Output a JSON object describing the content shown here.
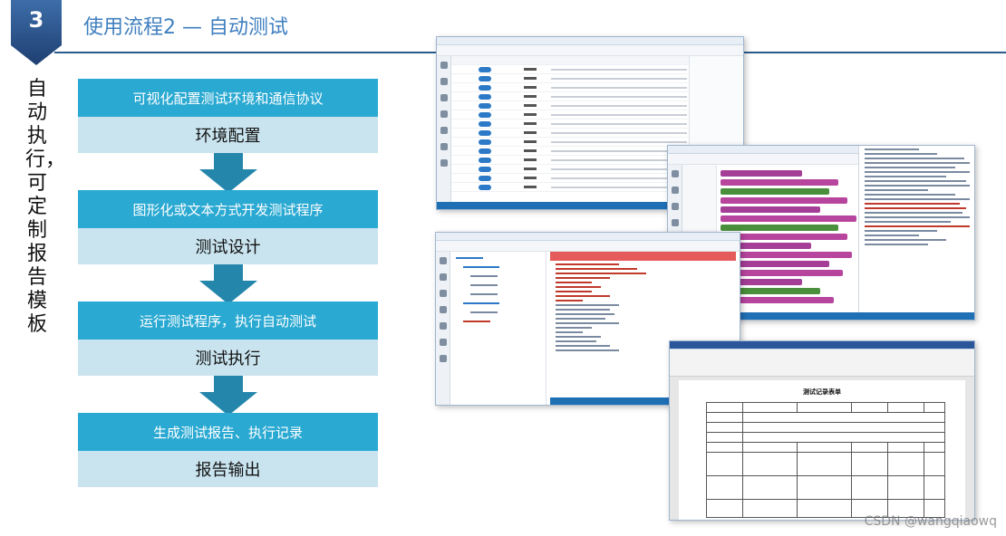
{
  "header": {
    "number": "3",
    "title": "使用流程2 — 自动测试"
  },
  "side_text": "自动执行，可定制报告模板",
  "flow": [
    {
      "action": "可视化配置测试环境和通信协议",
      "stage": "环境配置"
    },
    {
      "action": "图形化或文本方式开发测试程序",
      "stage": "测试设计"
    },
    {
      "action": "运行测试程序，执行自动测试",
      "stage": "测试执行"
    },
    {
      "action": "生成测试报告、执行记录",
      "stage": "报告输出"
    }
  ],
  "screens": {
    "doc_title": "测试记录表单"
  },
  "watermark": "CSDN @wangqiaowq"
}
